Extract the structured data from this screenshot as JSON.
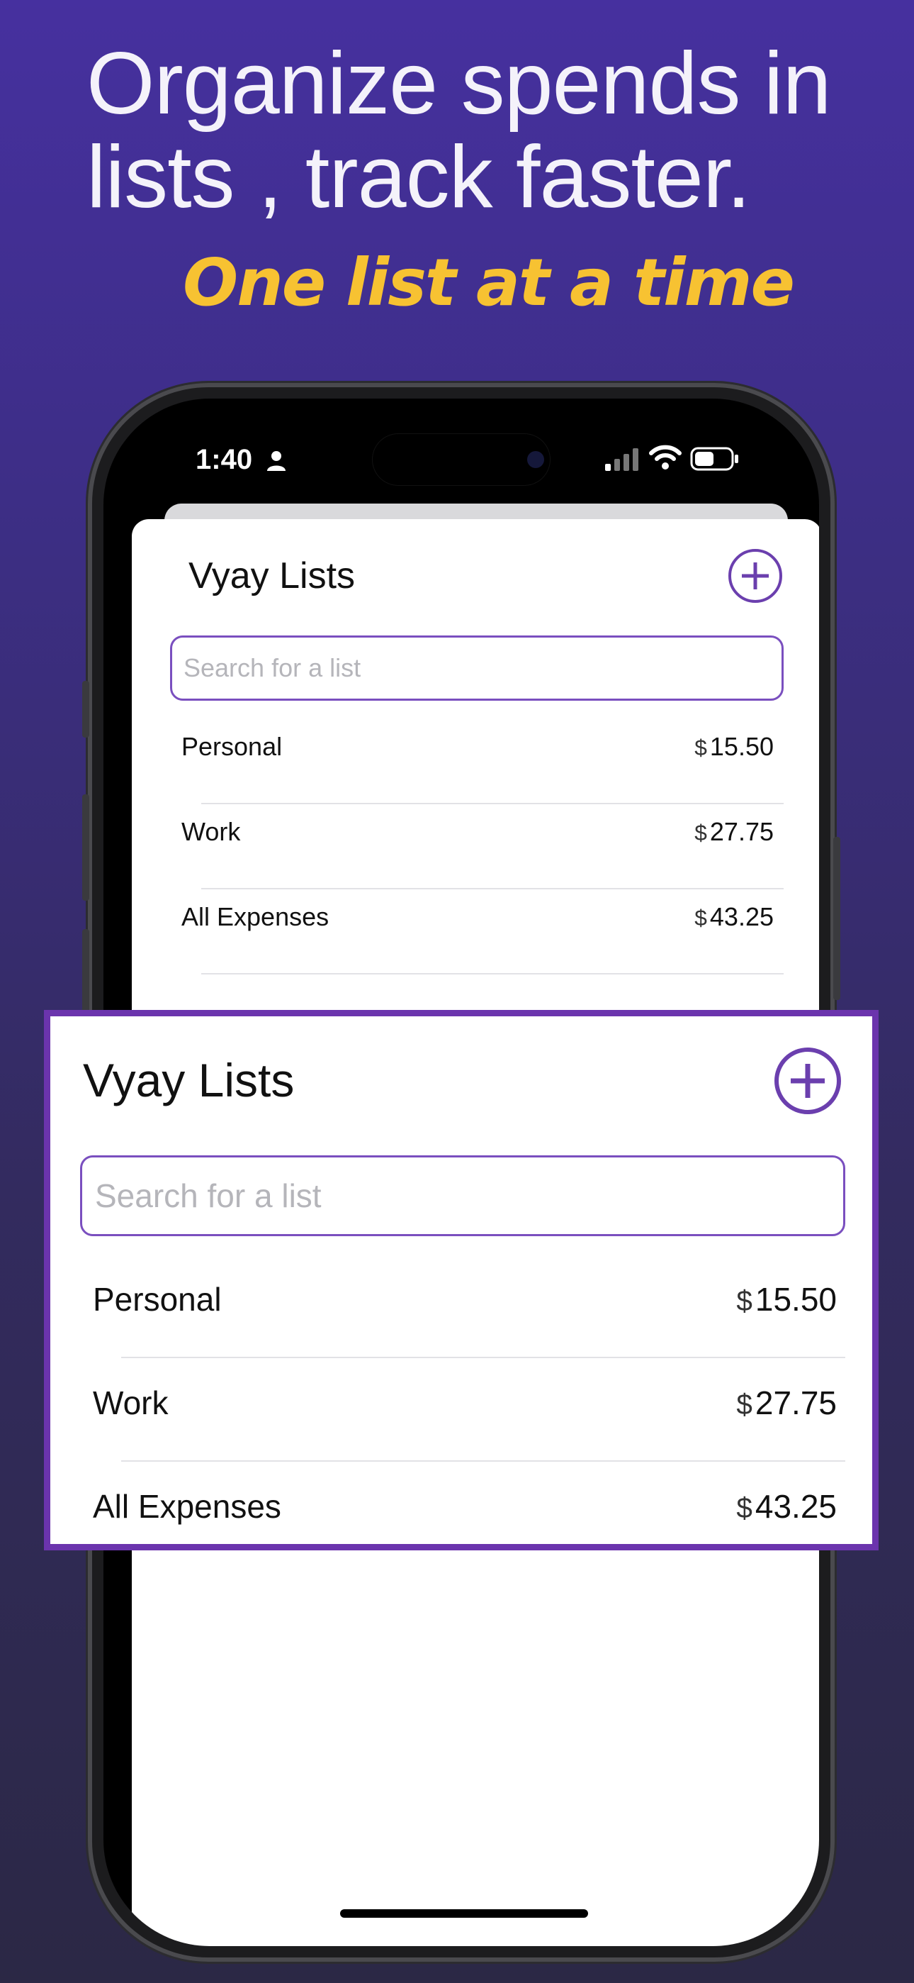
{
  "promo": {
    "headline": "Organize spends in lists , track faster.",
    "tagline": "One list at a time"
  },
  "status_bar": {
    "time": "1:40"
  },
  "app": {
    "title": "Vyay Lists",
    "search_placeholder": "Search for a list",
    "currency_symbol": "$",
    "lists": [
      {
        "name": "Personal",
        "amount": "15.50"
      },
      {
        "name": "Work",
        "amount": "27.75"
      },
      {
        "name": "All Expenses",
        "amount": "43.25"
      }
    ]
  },
  "colors": {
    "accent": "#6b3fae",
    "tagline": "#f7c232",
    "background_top": "#46309f",
    "background_bottom": "#2b2845"
  }
}
